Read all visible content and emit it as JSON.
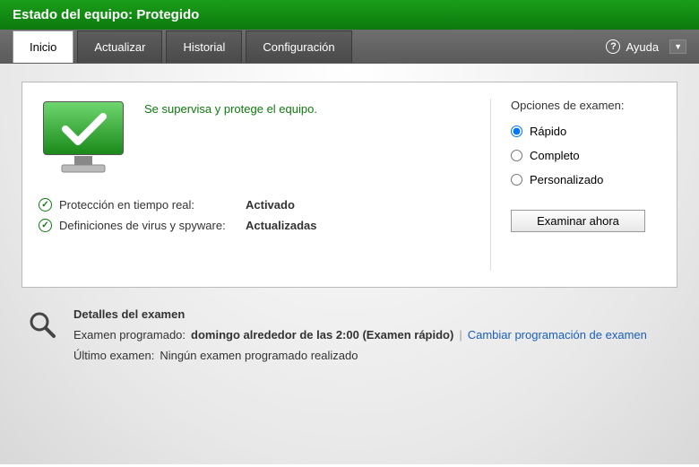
{
  "header": {
    "title": "Estado del equipo: Protegido"
  },
  "tabs": {
    "home": "Inicio",
    "update": "Actualizar",
    "history": "Historial",
    "settings": "Configuración",
    "help": "Ayuda"
  },
  "status": {
    "message": "Se supervisa y protege el equipo.",
    "realtime_label": "Protección en tiempo real:",
    "realtime_value": "Activado",
    "defs_label": "Definiciones de virus y spyware:",
    "defs_value": "Actualizadas"
  },
  "scan": {
    "title": "Opciones de examen:",
    "quick": "Rápido",
    "full": "Completo",
    "custom": "Personalizado",
    "button": "Examinar ahora"
  },
  "details": {
    "title": "Detalles del examen",
    "scheduled_label": "Examen programado:",
    "scheduled_value": "domingo alrededor de las 2:00 (Examen rápido)",
    "change_link": "Cambiar programación de examen",
    "last_label": "Último examen:",
    "last_value": "Ningún examen programado realizado"
  }
}
